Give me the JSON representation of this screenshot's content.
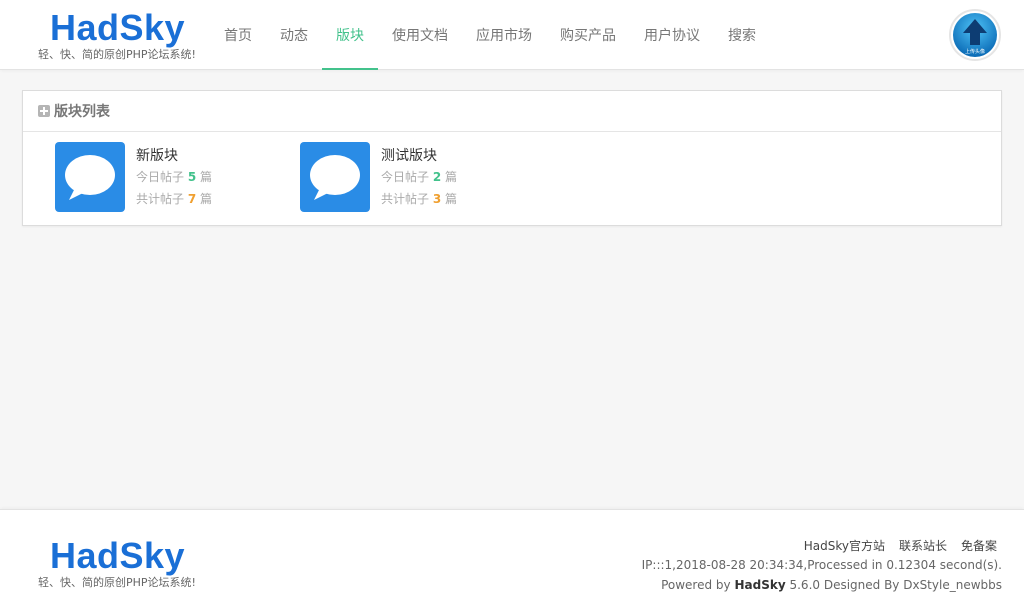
{
  "header": {
    "logo_title": "HadSky",
    "logo_subtitle": "轻、快、简的原创PHP论坛系统!",
    "nav": [
      {
        "label": "首页",
        "active": false
      },
      {
        "label": "动态",
        "active": false
      },
      {
        "label": "版块",
        "active": true
      },
      {
        "label": "使用文档",
        "active": false
      },
      {
        "label": "应用市场",
        "active": false
      },
      {
        "label": "购买产品",
        "active": false
      },
      {
        "label": "用户协议",
        "active": false
      },
      {
        "label": "搜索",
        "active": false
      }
    ],
    "avatar_label": "上传头像"
  },
  "panel": {
    "title": "版块列表",
    "forums": [
      {
        "name": "新版块",
        "today_label": "今日帖子",
        "today_count": "5",
        "total_label": "共计帖子",
        "total_count": "7",
        "unit": "篇"
      },
      {
        "name": "测试版块",
        "today_label": "今日帖子",
        "today_count": "2",
        "total_label": "共计帖子",
        "total_count": "3",
        "unit": "篇"
      }
    ]
  },
  "footer": {
    "logo_title": "HadSky",
    "logo_subtitle": "轻、快、简的原创PHP论坛系统!",
    "links": [
      "HadSky官方站",
      "联系站长",
      "免备案"
    ],
    "ip_line": "IP:::1,2018-08-28 20:34:34,Processed in 0.12304 second(s).",
    "powered_prefix": "Powered by",
    "powered_brand": "HadSky",
    "powered_suffix": "5.6.0 Designed By DxStyle_newbbs"
  },
  "colors": {
    "accent": "#43c28c",
    "brand_blue": "#1a6fd6",
    "forum_icon": "#2a8ce6",
    "total_count": "#f0a030"
  }
}
